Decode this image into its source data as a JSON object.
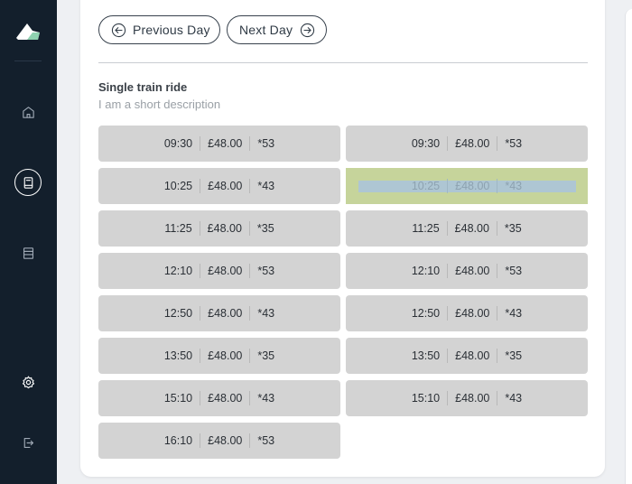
{
  "nav": {
    "items": [
      {
        "icon": "home-icon"
      },
      {
        "icon": "book-icon"
      },
      {
        "icon": "ticket-icon"
      },
      {
        "icon": "gear-icon"
      },
      {
        "icon": "logout-icon"
      }
    ]
  },
  "toolbar": {
    "prev_label": "Previous Day",
    "next_label": "Next Day"
  },
  "section": {
    "title": "Single train ride",
    "description": "I am a short description"
  },
  "rides_left": [
    {
      "time": "09:30",
      "price": "£48.00",
      "code": "*53"
    },
    {
      "time": "10:25",
      "price": "£48.00",
      "code": "*43"
    },
    {
      "time": "11:25",
      "price": "£48.00",
      "code": "*35"
    },
    {
      "time": "12:10",
      "price": "£48.00",
      "code": "*53"
    },
    {
      "time": "12:50",
      "price": "£48.00",
      "code": "*43"
    },
    {
      "time": "13:50",
      "price": "£48.00",
      "code": "*35"
    },
    {
      "time": "15:10",
      "price": "£48.00",
      "code": "*43"
    },
    {
      "time": "16:10",
      "price": "£48.00",
      "code": "*53"
    }
  ],
  "rides_right": [
    {
      "time": "09:30",
      "price": "£48.00",
      "code": "*53"
    },
    {
      "time": "10:25",
      "price": "£48.00",
      "code": "*43",
      "selected": true
    },
    {
      "time": "11:25",
      "price": "£48.00",
      "code": "*35"
    },
    {
      "time": "12:10",
      "price": "£48.00",
      "code": "*53"
    },
    {
      "time": "12:50",
      "price": "£48.00",
      "code": "*43"
    },
    {
      "time": "13:50",
      "price": "£48.00",
      "code": "*35"
    },
    {
      "time": "15:10",
      "price": "£48.00",
      "code": "*43"
    }
  ]
}
